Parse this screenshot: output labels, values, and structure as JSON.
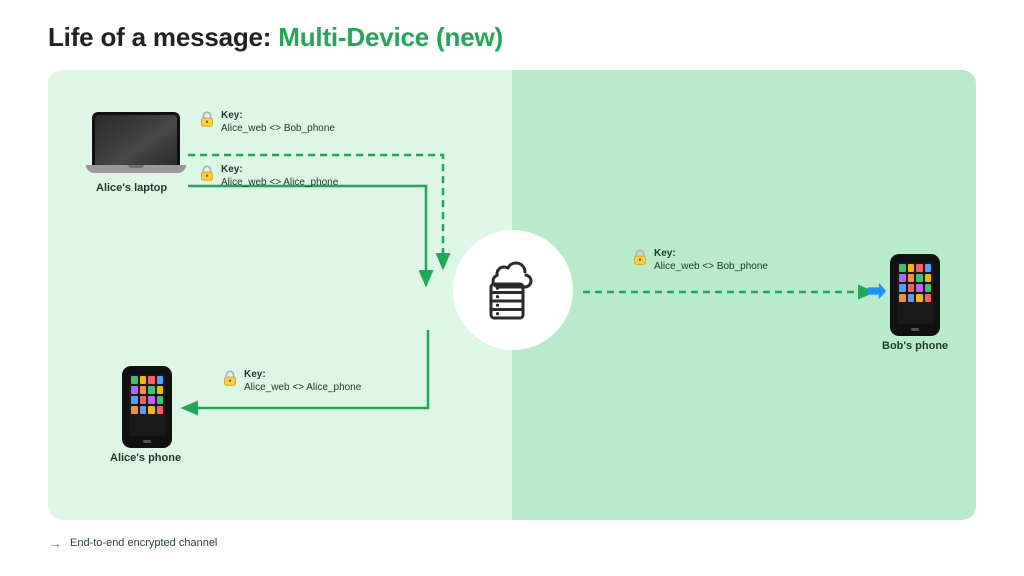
{
  "title": {
    "part1": "Life of a message: ",
    "part2": "Multi-Device (new)"
  },
  "devices": {
    "alice_laptop": "Alice's laptop",
    "alice_phone": "Alice's phone",
    "bob_phone": "Bob's phone"
  },
  "connections": [
    {
      "key_label": "Key:",
      "pair": "Alice_web <> Bob_phone"
    },
    {
      "key_label": "Key:",
      "pair": "Alice_web <> Alice_phone"
    },
    {
      "key_label": "Key:",
      "pair": "Alice_web <> Alice_phone"
    },
    {
      "key_label": "Key:",
      "pair": "Alice_web <> Bob_phone"
    }
  ],
  "legend": {
    "text": "End-to-end encrypted channel"
  },
  "colors": {
    "accent": "#1fa855",
    "panel_left": "#def6e6",
    "panel_right": "#b7ebc9"
  },
  "app_icon_colors": [
    "#3ac569",
    "#ffb400",
    "#ff5e5e",
    "#4aa3ff",
    "#b466ff",
    "#ff8a3d",
    "#3ac569",
    "#ffb400",
    "#4aa3ff",
    "#ff5e5e",
    "#b466ff",
    "#3ac569",
    "#ff8a3d",
    "#4aa3ff",
    "#ffb400",
    "#ff5e5e"
  ]
}
